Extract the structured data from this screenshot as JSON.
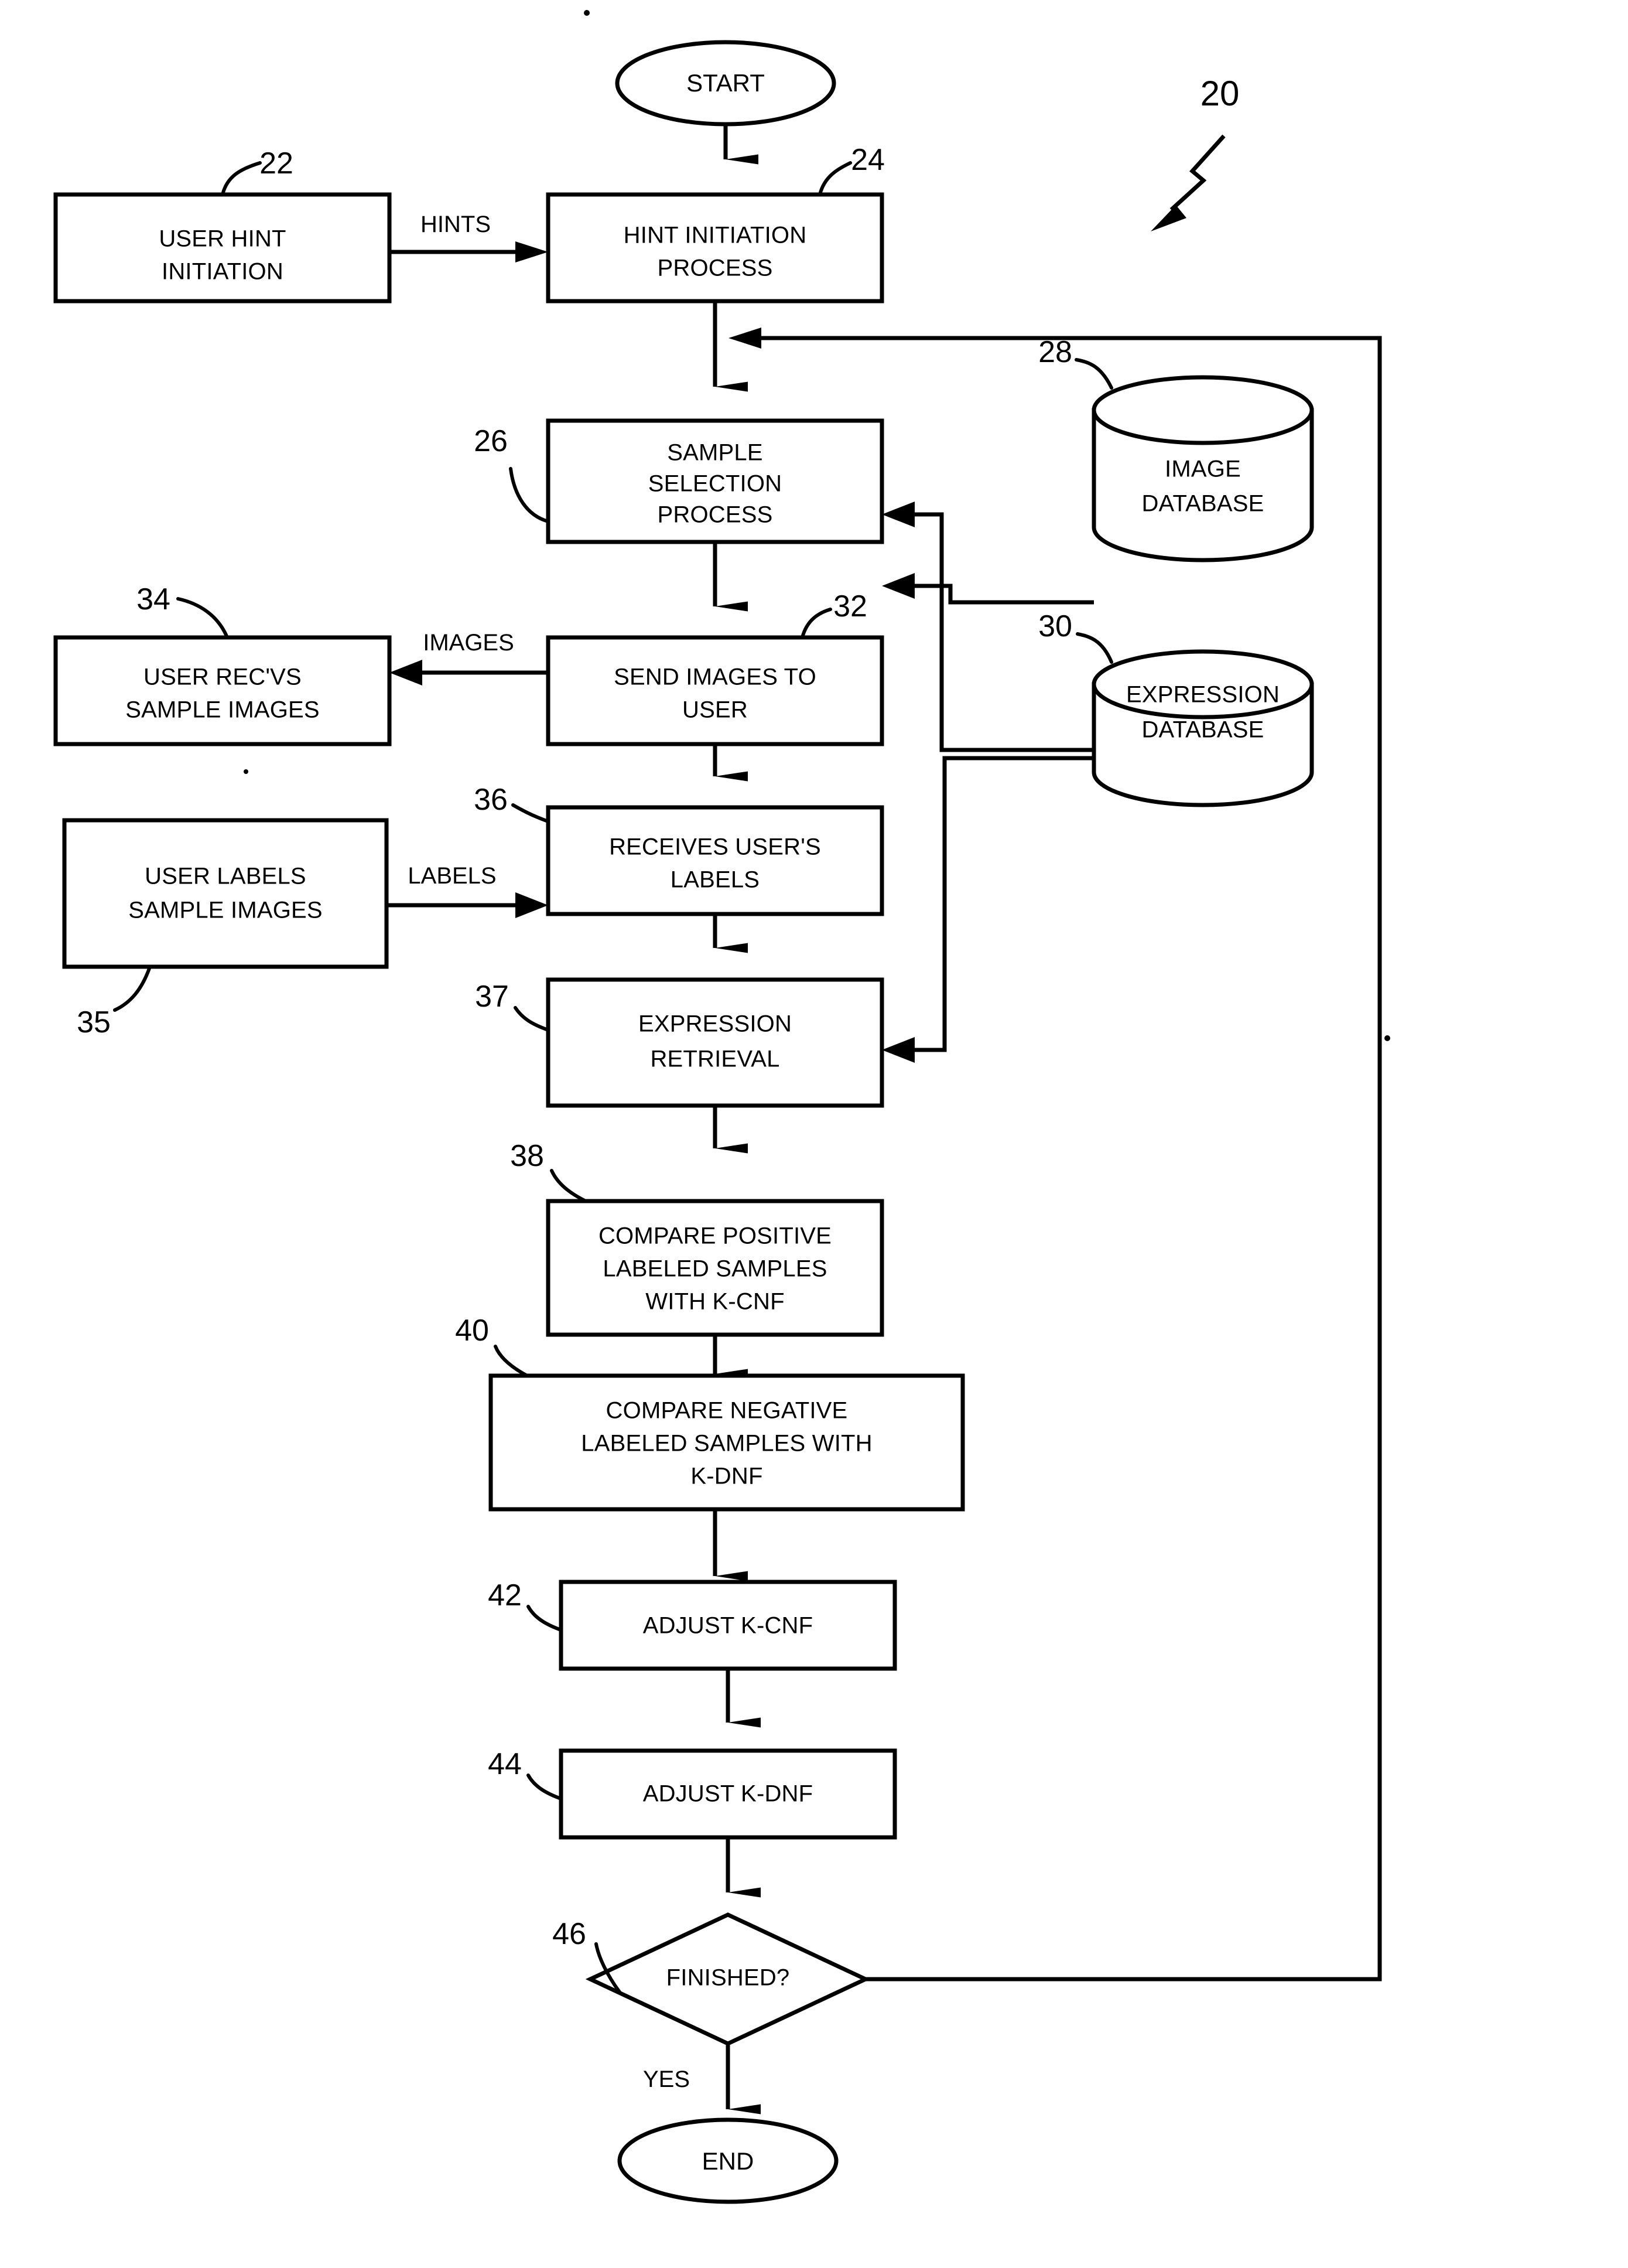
{
  "figure": {
    "figure_ref": "20",
    "nodes": {
      "start": {
        "label": "START"
      },
      "end": {
        "label": "END"
      },
      "user_hint_initiation": {
        "label_line1": "USER HINT",
        "label_line2": "INITIATION",
        "ref": "22"
      },
      "hint_initiation_process": {
        "label_line1": "HINT INITIATION",
        "label_line2": "PROCESS",
        "ref": "24"
      },
      "sample_selection_process": {
        "label_line1": "SAMPLE",
        "label_line2": "SELECTION",
        "label_line3": "PROCESS",
        "ref": "26"
      },
      "image_database": {
        "label_line1": "IMAGE",
        "label_line2": "DATABASE",
        "ref": "28"
      },
      "expression_database": {
        "label_line1": "EXPRESSION",
        "label_line2": "DATABASE",
        "ref": "30"
      },
      "send_images_to_user": {
        "label_line1": "SEND IMAGES TO",
        "label_line2": "USER",
        "ref": "32"
      },
      "user_recvs_sample_images": {
        "label_line1": "USER REC'VS",
        "label_line2": "SAMPLE IMAGES",
        "ref": "34"
      },
      "user_labels_sample_images": {
        "label_line1": "USER LABELS",
        "label_line2": "SAMPLE IMAGES",
        "ref": "35"
      },
      "receives_users_labels": {
        "label_line1": "RECEIVES USER'S",
        "label_line2": "LABELS",
        "ref": "36"
      },
      "expression_retrieval": {
        "label_line1": "EXPRESSION",
        "label_line2": "RETRIEVAL",
        "ref": "37"
      },
      "compare_positive": {
        "label_line1": "COMPARE POSITIVE",
        "label_line2": "LABELED SAMPLES",
        "label_line3": "WITH K-CNF",
        "ref": "38"
      },
      "compare_negative": {
        "label_line1": "COMPARE NEGATIVE",
        "label_line2": "LABELED SAMPLES WITH",
        "label_line3": "K-DNF",
        "ref": "40"
      },
      "adjust_kcnf": {
        "label": "ADJUST K-CNF",
        "ref": "42"
      },
      "adjust_kdnf": {
        "label": "ADJUST K-DNF",
        "ref": "44"
      },
      "finished_decision": {
        "label": "FINISHED?",
        "ref": "46"
      }
    },
    "edge_labels": {
      "hints": "HINTS",
      "images": "IMAGES",
      "labels": "LABELS",
      "yes": "YES"
    }
  }
}
